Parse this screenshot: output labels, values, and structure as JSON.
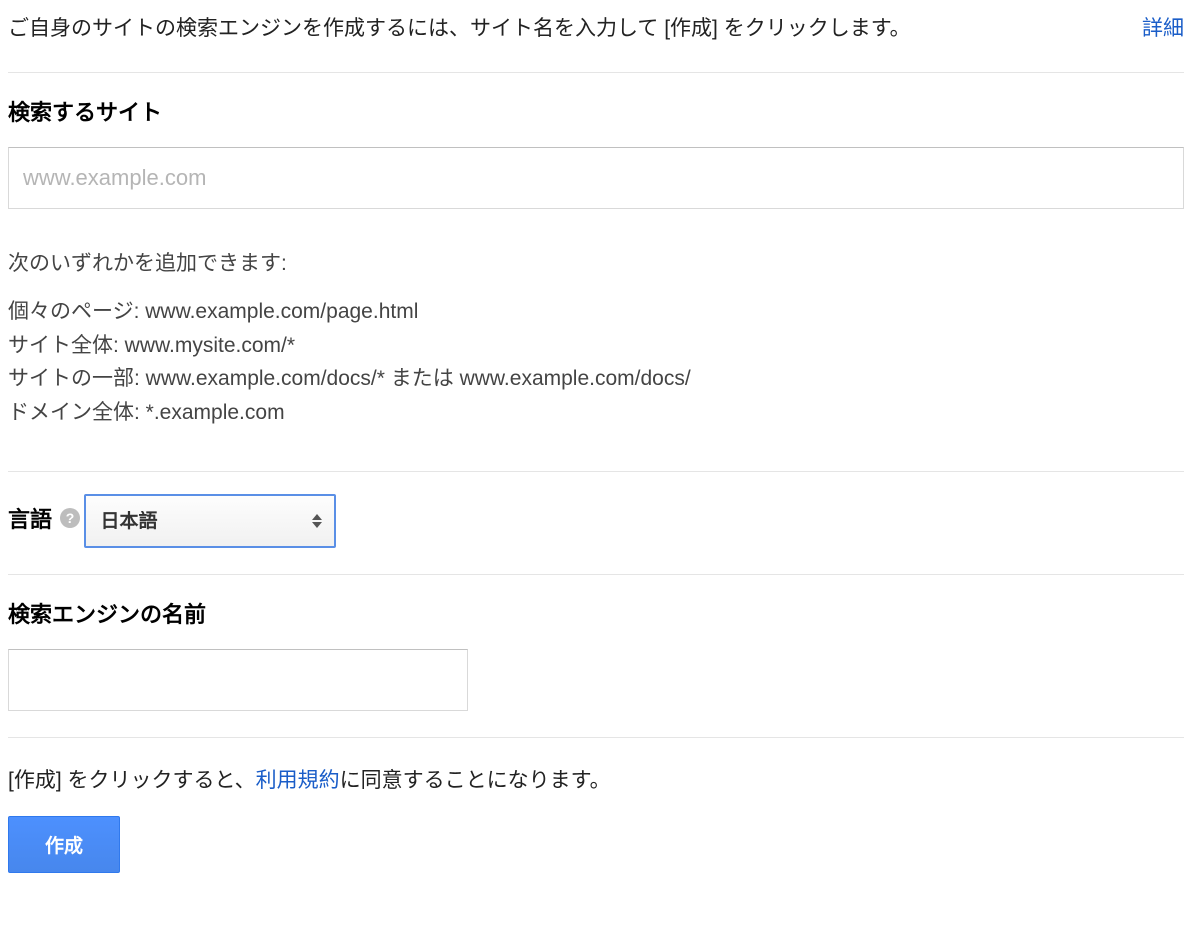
{
  "intro": {
    "text": "ご自身のサイトの検索エンジンを作成するには、サイト名を入力して [作成] をクリックします。",
    "detail_link": "詳細"
  },
  "sites": {
    "heading": "検索するサイト",
    "placeholder": "www.example.com",
    "value": "",
    "help_intro": "次のいずれかを追加できます:",
    "help_lines": [
      "個々のページ: www.example.com/page.html",
      "サイト全体: www.mysite.com/*",
      "サイトの一部: www.example.com/docs/* または www.example.com/docs/",
      "ドメイン全体: *.example.com"
    ]
  },
  "language": {
    "heading": "言語",
    "selected": "日本語"
  },
  "engine_name": {
    "heading": "検索エンジンの名前",
    "value": ""
  },
  "terms": {
    "prefix": "[作成] をクリックすると、",
    "link": "利用規約",
    "suffix": "に同意することになります。"
  },
  "create_button": "作成"
}
